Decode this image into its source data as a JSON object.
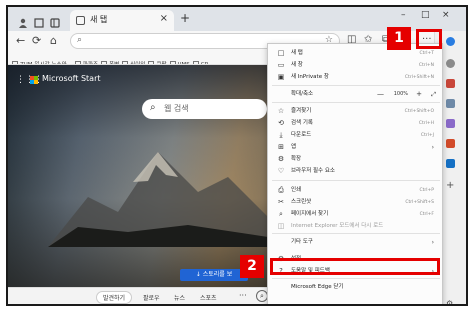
{
  "tab": {
    "title": "새 탭"
  },
  "address": {
    "value": ""
  },
  "favorites": [
    "ZUM-일시간 뉴스와...",
    "파파조",
    "폭변",
    "신이익",
    "쿠팡",
    "UMS",
    "CR"
  ],
  "page": {
    "brand": "Microsoft Start",
    "search_placeholder": "웹 검색",
    "stories_button": "↓ 스토리를 보",
    "bottom_tabs": [
      "발견하기",
      "팔로우",
      "뉴스",
      "스포츠"
    ]
  },
  "menu": {
    "items": [
      {
        "icon": "□",
        "label": "새 탭",
        "shortcut": "Ctrl+T"
      },
      {
        "icon": "▭",
        "label": "새 창",
        "shortcut": "Ctrl+N"
      },
      {
        "icon": "▣",
        "label": "새 InPrivate 창",
        "shortcut": "Ctrl+Shift+N"
      },
      {
        "icon": "",
        "label": "확대/축소",
        "zoom": "100%"
      },
      {
        "icon": "☆",
        "label": "즐겨찾기",
        "shortcut": "Ctrl+Shift+O"
      },
      {
        "icon": "⟲",
        "label": "검색 기록",
        "shortcut": "Ctrl+H"
      },
      {
        "icon": "⤓",
        "label": "다운로드",
        "shortcut": "Ctrl+J"
      },
      {
        "icon": "⊞",
        "label": "앱",
        "arrow": "›"
      },
      {
        "icon": "⚙",
        "label": "확장",
        "shortcut": ""
      },
      {
        "icon": "♡",
        "label": "브라우저 필수 요소",
        "shortcut": ""
      },
      {
        "icon": "⎙",
        "label": "인쇄",
        "shortcut": "Ctrl+P"
      },
      {
        "icon": "✂",
        "label": "스크린샷",
        "shortcut": "Ctrl+Shift+S"
      },
      {
        "icon": "⌕",
        "label": "페이지에서 찾기",
        "shortcut": "Ctrl+F"
      },
      {
        "icon": "◫",
        "label": "Internet Explorer 모드에서 다시 로드",
        "shortcut": "",
        "disabled": true
      },
      {
        "icon": "",
        "label": "기타 도구",
        "arrow": "›"
      },
      {
        "icon": "⚙",
        "label": "설정",
        "shortcut": ""
      },
      {
        "icon": "?",
        "label": "도움말 및 피드백",
        "arrow": "›"
      },
      {
        "icon": "",
        "label": "Microsoft Edge 닫기",
        "shortcut": ""
      }
    ]
  },
  "callouts": {
    "step1": "1",
    "step2": "2"
  },
  "colors": {
    "callout": "#e50000",
    "accent": "#2064d4"
  }
}
